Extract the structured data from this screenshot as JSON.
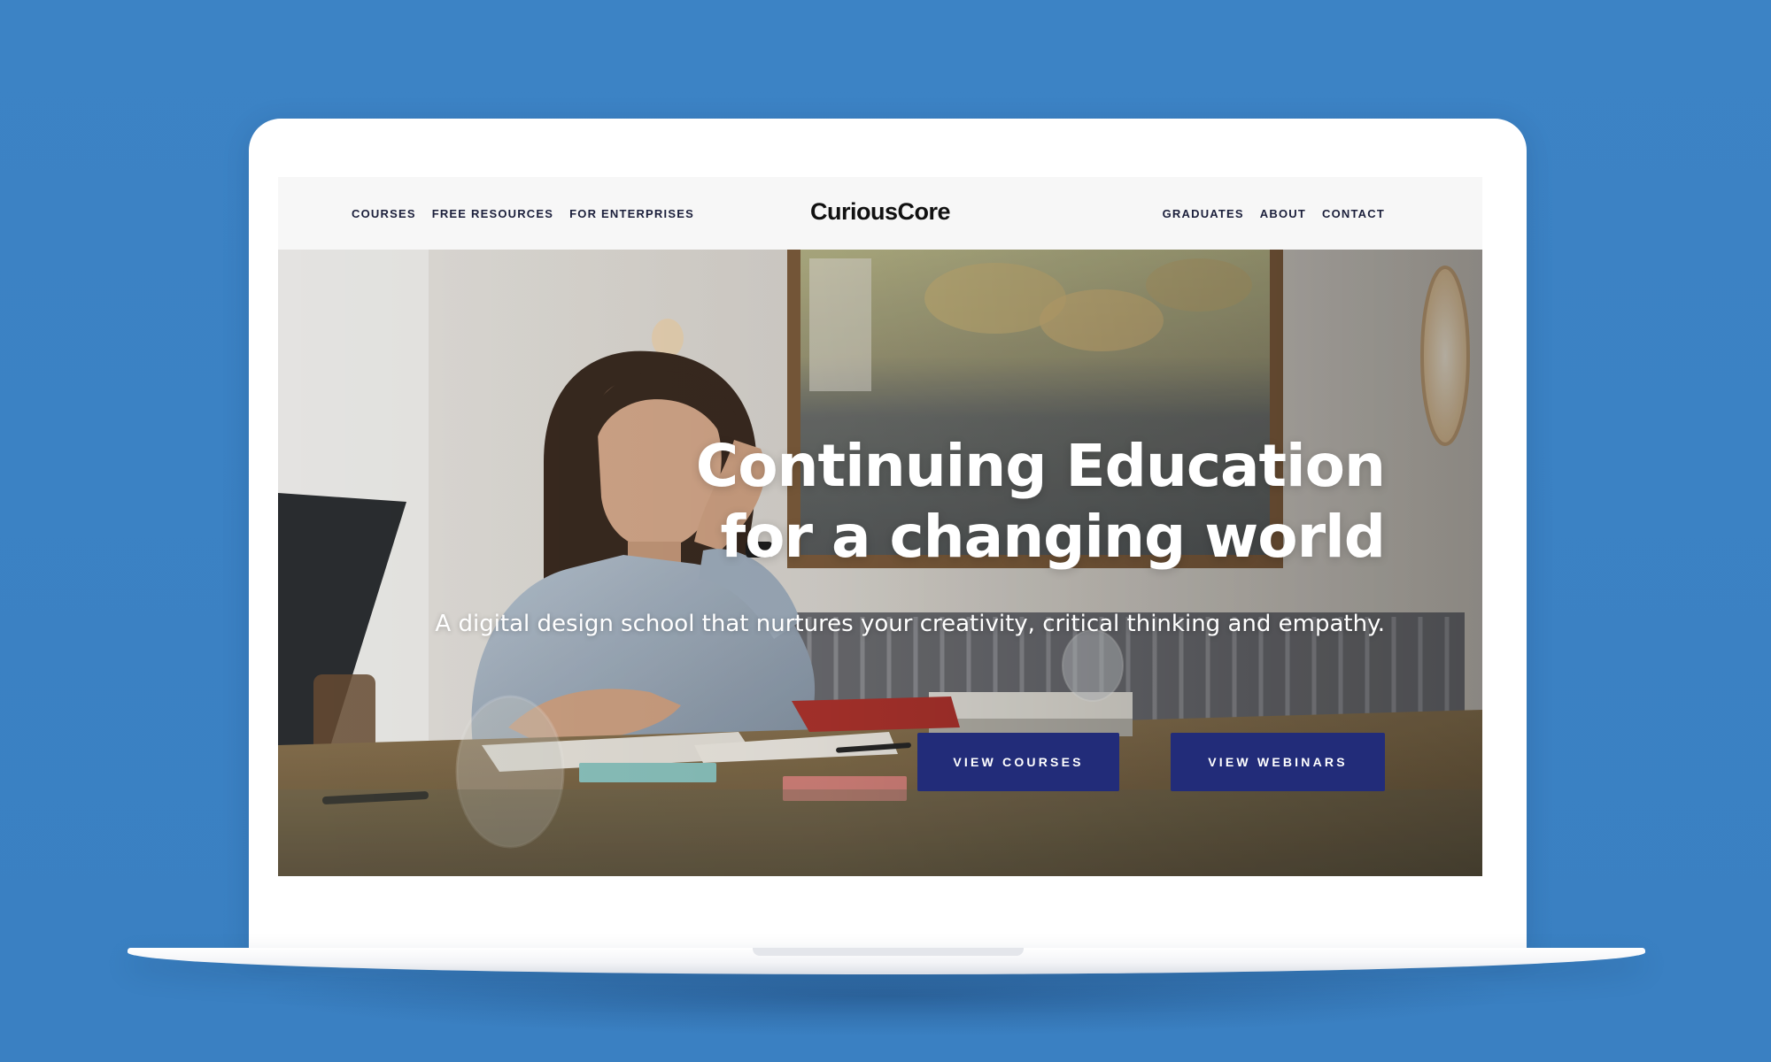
{
  "site": {
    "logo": "CuriousCore"
  },
  "nav": {
    "left": [
      "COURSES",
      "FREE RESOURCES",
      "FOR ENTERPRISES"
    ],
    "right": [
      "GRADUATES",
      "ABOUT",
      "CONTACT"
    ]
  },
  "hero": {
    "headline_line1": "Continuing Education",
    "headline_line2": "for a changing world",
    "subheadline": "A digital design school that nurtures your creativity, critical thinking and empathy.",
    "buttons": {
      "courses": "VIEW COURSES",
      "webinars": "VIEW WEBINARS"
    }
  },
  "colors": {
    "background": "#3b82c4",
    "button": "#222c79",
    "nav_text": "#1b1f3b"
  }
}
